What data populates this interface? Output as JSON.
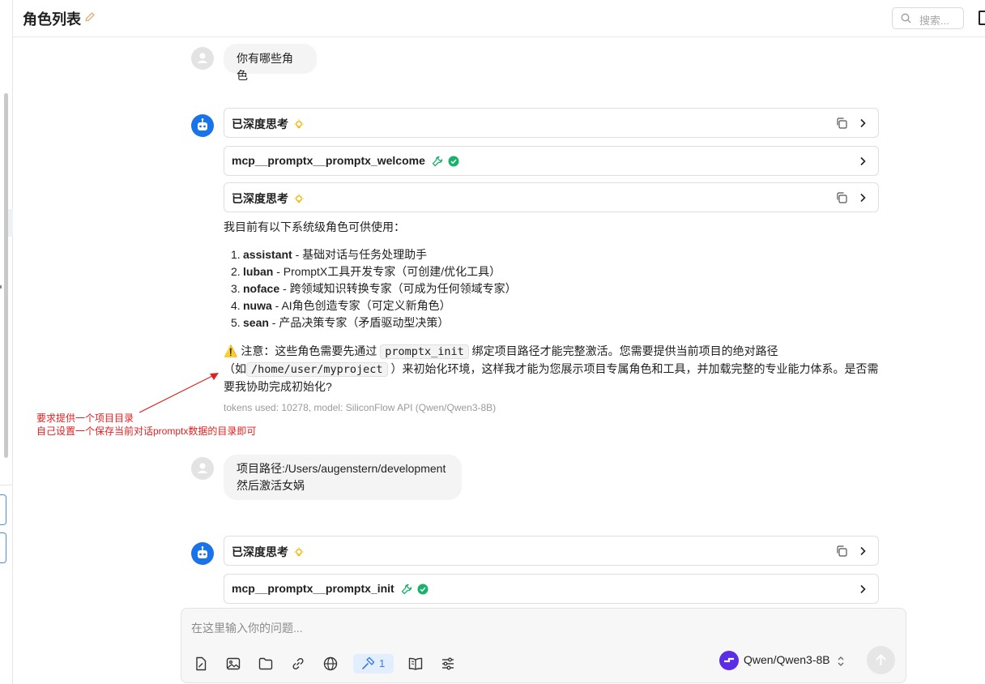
{
  "header": {
    "title": "角色列表",
    "search_placeholder": "搜索..."
  },
  "messages": {
    "user1": "你有哪些角色",
    "thinking_label": "已深度思考",
    "tool1_label": "mcp__promptx__promptx_welcome",
    "answer_intro": "我目前有以下系统级角色可供使用：",
    "roles": [
      {
        "num": "1.",
        "name": "assistant",
        "desc": " - 基础对话与任务处理助手"
      },
      {
        "num": "2.",
        "name": "luban",
        "desc": " - PromptX工具开发专家（可创建/优化工具）"
      },
      {
        "num": "3.",
        "name": "noface",
        "desc": " - 跨领域知识转换专家（可成为任何领域专家）"
      },
      {
        "num": "4.",
        "name": "nuwa",
        "desc": " - AI角色创造专家（可定义新角色）"
      },
      {
        "num": "5.",
        "name": "sean",
        "desc": " - 产品决策专家（矛盾驱动型决策）"
      }
    ],
    "note_prefix": "⚠️ 注意：这些角色需要先通过",
    "note_code1": "promptx_init",
    "note_mid": "绑定项目路径才能完整激活。您需要提供当前项目的绝对路径（如",
    "note_code2": "/home/user/myproject",
    "note_suffix": "）来初始化环境，这样我才能为您展示项目专属角色和工具，并加载完整的专业能力体系。是否需要我协助完成初始化?",
    "tokens": "tokens used: 10278, model: SiliconFlow API (Qwen/Qwen3-8B)",
    "user2_line1": "项目路径:/Users/augenstern/development",
    "user2_line2": "然后激活女娲",
    "tool2_label": "mcp__promptx__promptx_init"
  },
  "annotation": {
    "line1": "要求提供一个项目目录",
    "line2": "自己设置一个保存当前对话promptx数据的目录即可"
  },
  "input": {
    "placeholder": "在这里输入你的问题...",
    "mcp_count": "1",
    "model": "Qwen/Qwen3-8B"
  },
  "colors": {
    "accent": "#1a73e8",
    "annotation": "#e02020",
    "success": "#18b26b",
    "bulb": "#f0b400"
  }
}
